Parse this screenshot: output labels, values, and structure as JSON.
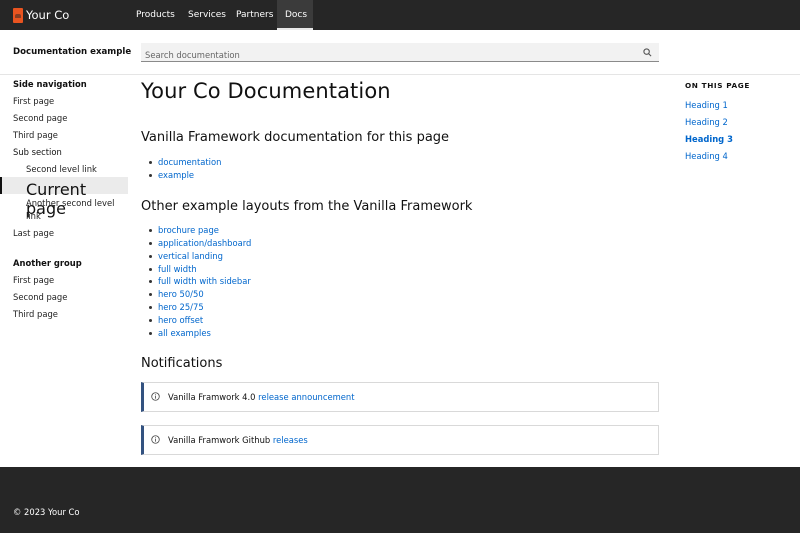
{
  "brand": {
    "name": "Your Co"
  },
  "topnav": {
    "items": [
      {
        "label": "Products"
      },
      {
        "label": "Services"
      },
      {
        "label": "Partners"
      },
      {
        "label": "Docs"
      }
    ],
    "active": "Docs"
  },
  "subbar": {
    "title": "Documentation example",
    "search_placeholder": "Search documentation",
    "search_icon": "search-icon"
  },
  "sidenav": {
    "group1_heading": "Side navigation",
    "items": [
      {
        "label": "First page"
      },
      {
        "label": "Second page"
      },
      {
        "label": "Third page"
      }
    ],
    "sub_heading": "Sub section",
    "sub_items": [
      {
        "label": "Second level link"
      },
      {
        "label": "Current page"
      },
      {
        "label": "Another second level"
      },
      {
        "label": "link"
      }
    ],
    "last": "Last page",
    "group2_heading": "Another group",
    "group2_items": [
      {
        "label": "First page"
      },
      {
        "label": "Second page"
      },
      {
        "label": "Third page"
      }
    ]
  },
  "main": {
    "title": "Your Co Documentation",
    "section1_heading": "Vanilla Framework documentation for this page",
    "section1_links": [
      {
        "label": "documentation"
      },
      {
        "label": "example"
      }
    ],
    "section2_heading": "Other example layouts from the Vanilla Framework",
    "section2_links": [
      {
        "label": "brochure page"
      },
      {
        "label": "application/dashboard"
      },
      {
        "label": "vertical landing"
      },
      {
        "label": "full width"
      },
      {
        "label": "full width with sidebar"
      },
      {
        "label": "hero 50/50"
      },
      {
        "label": "hero 25/75"
      },
      {
        "label": "hero offset"
      },
      {
        "label": "all examples"
      }
    ],
    "notifications_heading": "Notifications",
    "notifications": [
      {
        "text": "Vanilla Framwork 4.0 ",
        "link": "release announcement"
      },
      {
        "text": "Vanilla Framwork Github ",
        "link": "releases"
      }
    ]
  },
  "toc": {
    "title": "ON THIS PAGE",
    "items": [
      {
        "label": "Heading 1"
      },
      {
        "label": "Heading 2"
      },
      {
        "label": "Heading 3"
      },
      {
        "label": "Heading 4"
      }
    ],
    "active": "Heading 3"
  },
  "footer": {
    "text": "© 2023 Your Co"
  },
  "colors": {
    "accent": "#e95420",
    "link": "#0066cc",
    "nav_bg": "#262626",
    "notification_border": "#335280"
  }
}
